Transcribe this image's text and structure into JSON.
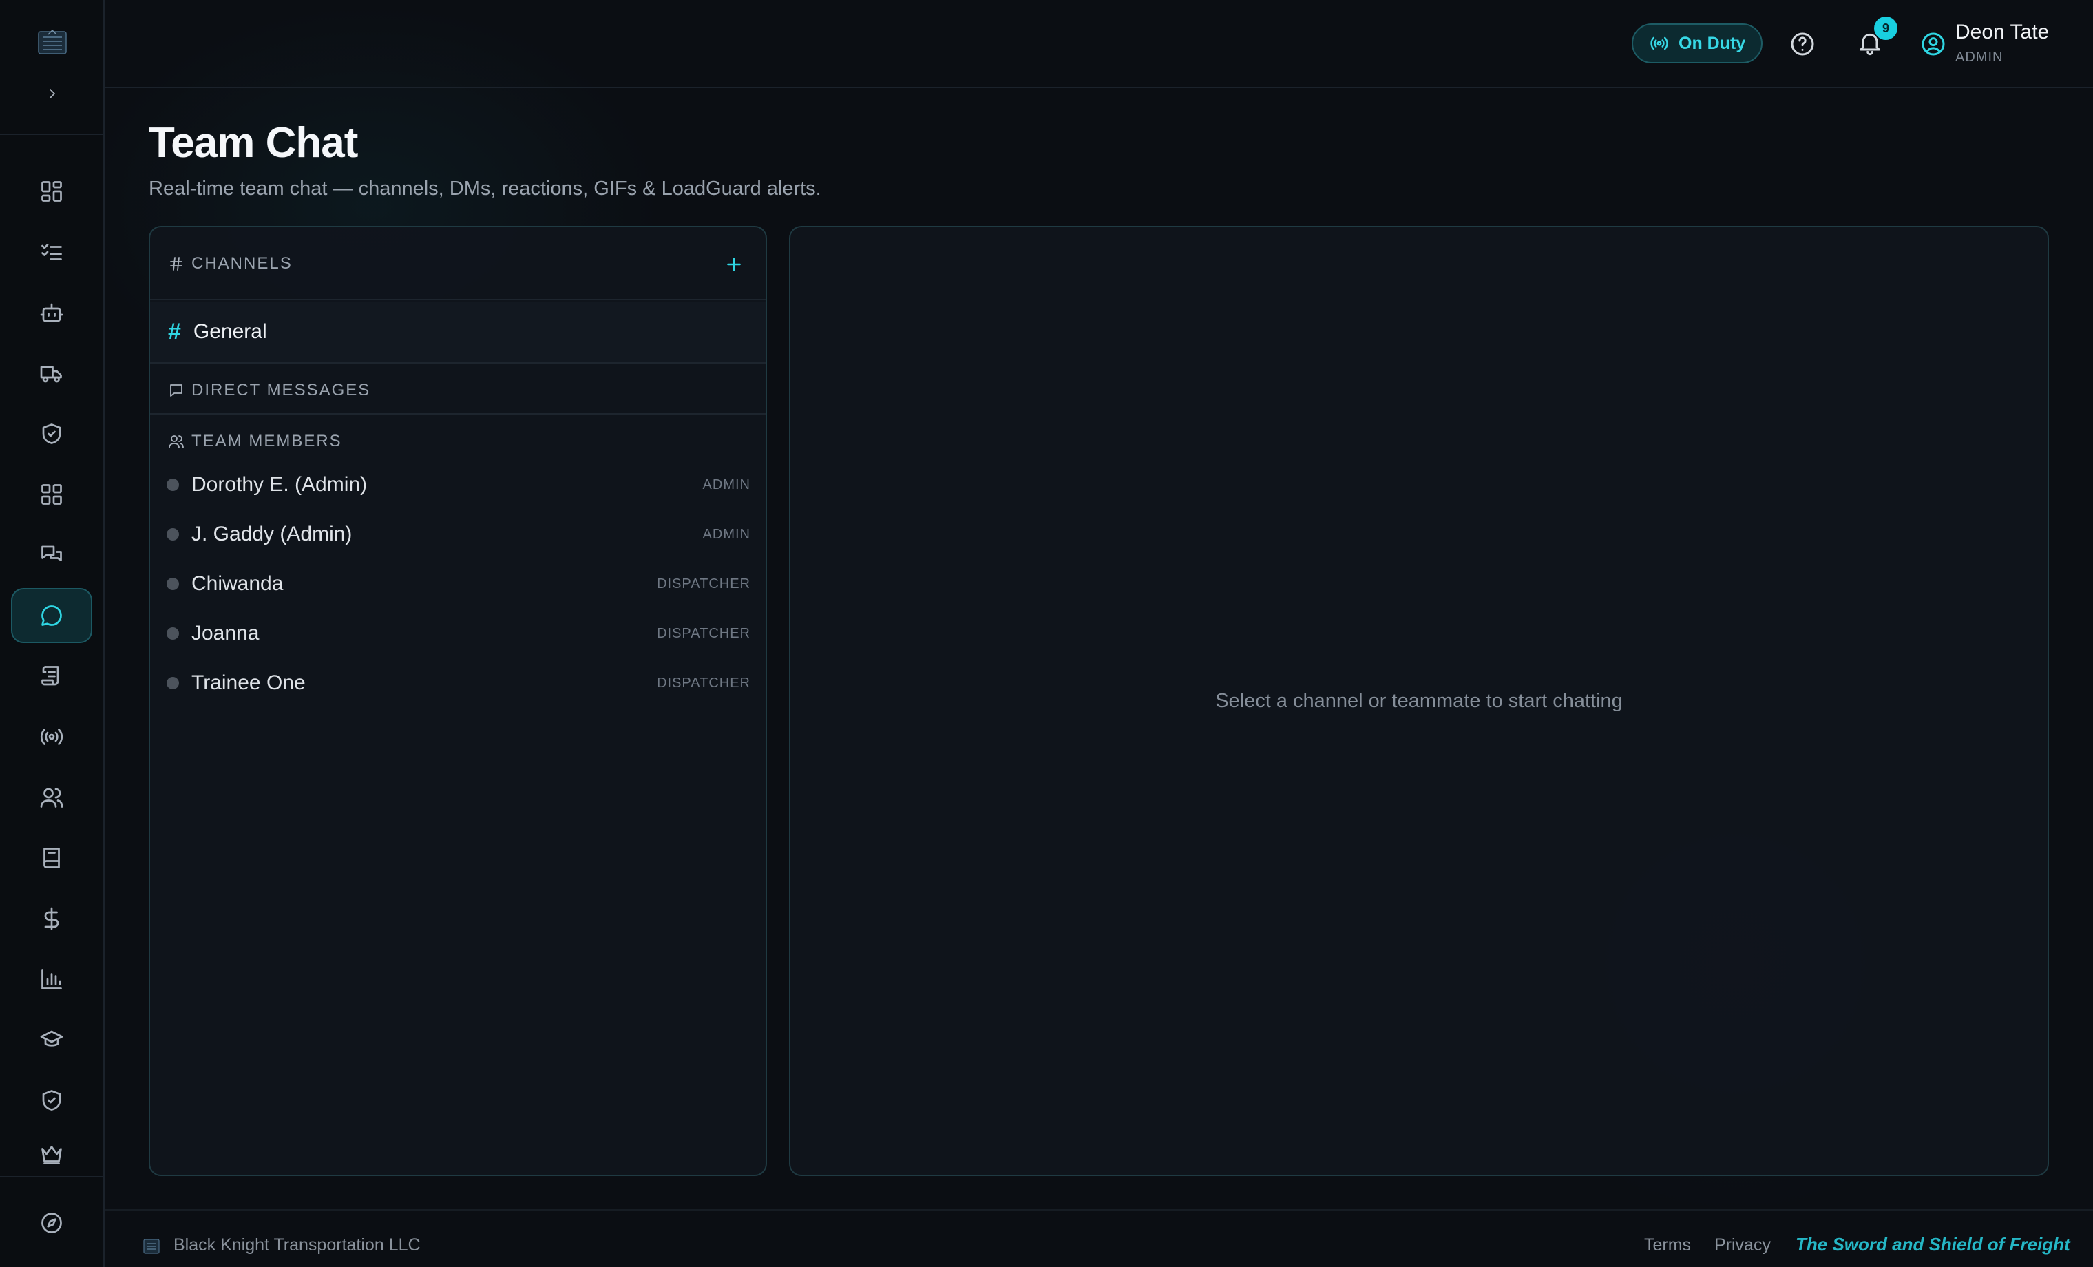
{
  "header": {
    "status_label": "On Duty",
    "notification_count": "9",
    "user": {
      "name": "Deon Tate",
      "role": "ADMIN"
    }
  },
  "page": {
    "title": "Team Chat",
    "subtitle": "Real-time team chat — channels, DMs, reactions, GIFs & LoadGuard alerts."
  },
  "sidebar": {
    "items": [
      {
        "icon": "dashboard-icon"
      },
      {
        "icon": "checklist-icon"
      },
      {
        "icon": "bot-icon"
      },
      {
        "icon": "truck-icon"
      },
      {
        "icon": "shield-check-icon"
      },
      {
        "icon": "apps-grid-icon"
      },
      {
        "icon": "messages-icon"
      },
      {
        "icon": "chat-icon",
        "active": true
      },
      {
        "icon": "scroll-icon"
      },
      {
        "icon": "broadcast-icon"
      },
      {
        "icon": "users-icon"
      },
      {
        "icon": "book-icon"
      },
      {
        "icon": "dollar-icon"
      },
      {
        "icon": "bar-chart-icon"
      },
      {
        "icon": "graduation-cap-icon"
      },
      {
        "icon": "shield-check-icon"
      },
      {
        "icon": "crown-icon"
      }
    ],
    "bottom_icon": "compass-icon"
  },
  "chat": {
    "channels_label": "CHANNELS",
    "channels": [
      {
        "name": "General"
      }
    ],
    "dm_label": "DIRECT MESSAGES",
    "members_label": "TEAM MEMBERS",
    "members": [
      {
        "name": "Dorothy E. (Admin)",
        "role": "ADMIN"
      },
      {
        "name": "J. Gaddy (Admin)",
        "role": "ADMIN"
      },
      {
        "name": "Chiwanda",
        "role": "DISPATCHER"
      },
      {
        "name": "Joanna",
        "role": "DISPATCHER"
      },
      {
        "name": "Trainee One",
        "role": "DISPATCHER"
      }
    ],
    "empty_state": "Select a channel or teammate to start chatting"
  },
  "footer": {
    "company": "Black Knight Transportation LLC",
    "terms": "Terms",
    "privacy": "Privacy",
    "tagline": "The Sword and Shield of Freight"
  },
  "colors": {
    "accent": "#2fd6e3",
    "background": "#0b0e13",
    "panel_border": "#1f3a42"
  }
}
